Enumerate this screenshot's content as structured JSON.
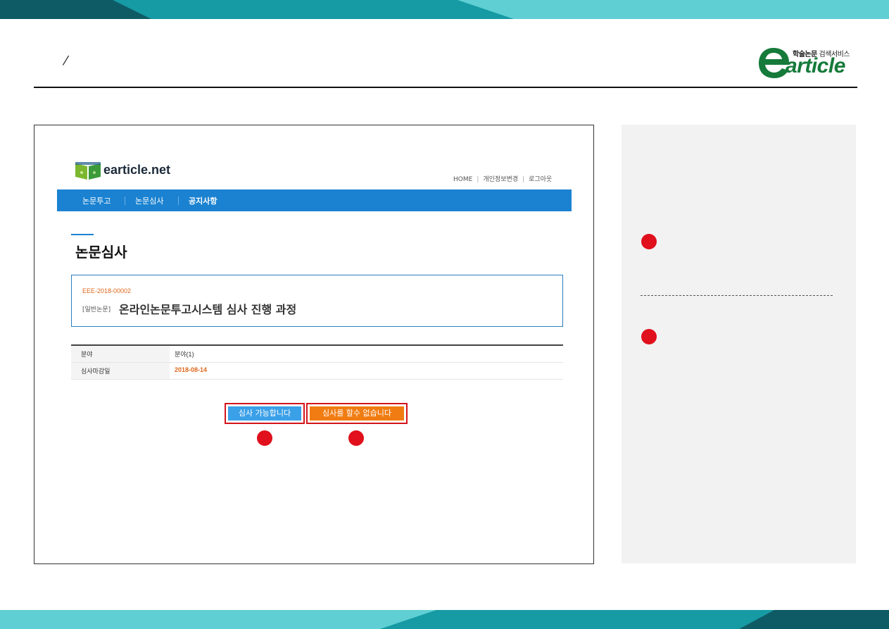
{
  "header": {
    "slash_mark": "⁄",
    "brand": {
      "tagline_bold": "학술논문",
      "tagline": "검색서비스",
      "word": "article"
    }
  },
  "screen": {
    "site_name": "earticle.net",
    "util_links": [
      "HOME",
      "개인정보변경",
      "로그아웃"
    ],
    "nav": [
      "논문투고",
      "논문심사",
      "공지사항"
    ],
    "page_title": "논문심사",
    "paper": {
      "id": "EEE-2018-00002",
      "type": "[일반논문]",
      "title": "온라인논문투고시스템 심사 진행 과정"
    },
    "info_rows": [
      {
        "label": "분야",
        "value": "분야(1)"
      },
      {
        "label": "심사마감일",
        "value": "2018-08-14"
      }
    ],
    "accept_button": "심사 가능합니다",
    "decline_button": "심사를 할수 없습니다"
  },
  "colors": {
    "top_band": [
      "#0e5b66",
      "#169aa4",
      "#5fcfd3"
    ],
    "nav_blue": "#1b82d1",
    "marker_red": "#e0101c",
    "accent_orange": "#f07c12"
  }
}
